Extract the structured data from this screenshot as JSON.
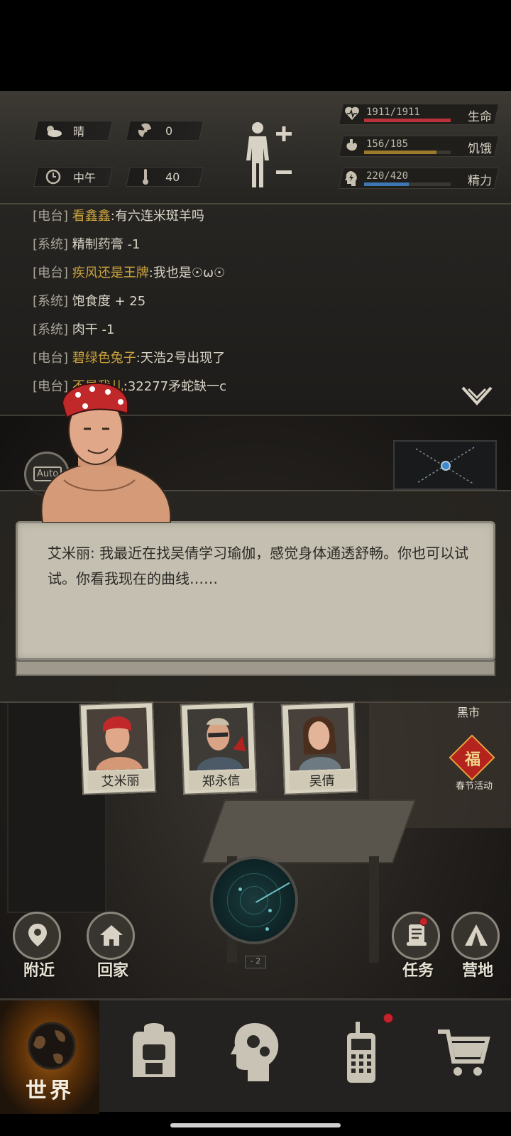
{
  "status": {
    "weather": {
      "icon": "cloud-sun-icon",
      "text": "晴"
    },
    "radiation": {
      "icon": "radiation-icon",
      "text": "0"
    },
    "time": {
      "icon": "clock-icon",
      "text": "中午"
    },
    "temperature": {
      "icon": "thermometer-icon",
      "text": "40"
    },
    "stats": [
      {
        "key": "life",
        "icon": "heart-rate-icon",
        "value": "1911/1911",
        "label": "生命",
        "fraction": 1.0,
        "color": "#b9313a"
      },
      {
        "key": "hunger",
        "icon": "stomach-icon",
        "value": "156/185",
        "label": "饥饿",
        "fraction": 0.84,
        "color": "#9c7a2c"
      },
      {
        "key": "energy",
        "icon": "head-bolt-icon",
        "value": "220/420",
        "label": "精力",
        "fraction": 0.52,
        "color": "#3c76b3"
      }
    ]
  },
  "log": [
    {
      "tag": "[电台]",
      "who": "看鑫鑫",
      "msg": ":有六连米斑羊吗"
    },
    {
      "tag": "[系统]",
      "who": "",
      "msg": "精制药膏 -1"
    },
    {
      "tag": "[电台]",
      "who": "疾风还是王牌",
      "msg": ":我也是☉ω☉"
    },
    {
      "tag": "[系统]",
      "who": "",
      "msg": "饱食度 + 25"
    },
    {
      "tag": "[系统]",
      "who": "",
      "msg": "肉干 -1"
    },
    {
      "tag": "[电台]",
      "who": "碧绿色兔子",
      "msg": ":天浩2号出现了"
    },
    {
      "tag": "[电台]",
      "who": "不是我儿",
      "msg": ":32277矛蛇缺一c"
    }
  ],
  "auto_label": "Auto",
  "dialog": {
    "text": "艾米丽: 我最近在找吴倩学习瑜伽，感觉身体通透舒畅。你也可以试试。你看我现在的曲线……"
  },
  "npcs": [
    {
      "name": "艾米丽"
    },
    {
      "name": "郑永信"
    },
    {
      "name": "吴倩"
    }
  ],
  "side": {
    "black_market": "黑市",
    "spring_festival": "春节活动",
    "fu_char": "福"
  },
  "actions": {
    "nearby": "附近",
    "home": "回家",
    "tasks": "任务",
    "camp": "营地"
  },
  "radar_count": "- 2",
  "nav": {
    "world": "世界"
  }
}
